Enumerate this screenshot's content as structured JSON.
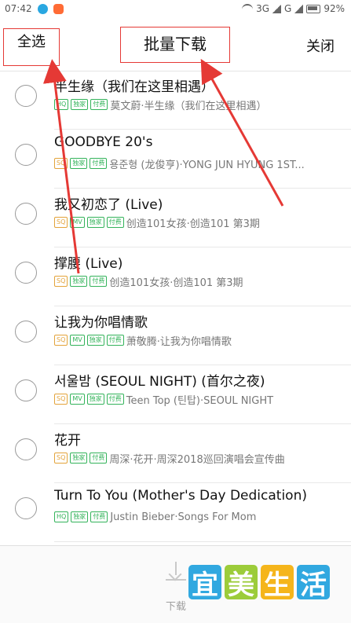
{
  "status_bar": {
    "time": "07:42",
    "network": "3G",
    "network2": "G",
    "battery": "92%"
  },
  "header": {
    "select_all": "全选",
    "title": "批量下载",
    "close": "关闭"
  },
  "songs": [
    {
      "title": "半生缘（我们在这里相遇）",
      "tags": [
        "HQ",
        "独家",
        "付费"
      ],
      "subtitle": "莫文蔚·半生缘（我们在这里相遇）"
    },
    {
      "title": "GOODBYE 20's",
      "tags": [
        "SQ",
        "独家",
        "付费"
      ],
      "subtitle": "용준형 (龙俊亨)·YONG JUN HYUNG 1ST..."
    },
    {
      "title": "我又初恋了 (Live)",
      "tags": [
        "SQ",
        "MV",
        "独家",
        "付费"
      ],
      "subtitle": "创造101女孩·创造101 第3期"
    },
    {
      "title": "撑腰 (Live)",
      "tags": [
        "SQ",
        "独家",
        "付费"
      ],
      "subtitle": "创造101女孩·创造101 第3期"
    },
    {
      "title": "让我为你唱情歌",
      "tags": [
        "SQ",
        "MV",
        "独家",
        "付费"
      ],
      "subtitle": "萧敬腾·让我为你唱情歌"
    },
    {
      "title": "서울밤 (SEOUL NIGHT) (首尔之夜)",
      "tags": [
        "SQ",
        "MV",
        "独家",
        "付费"
      ],
      "subtitle": "Teen Top (틴탑)·SEOUL NIGHT"
    },
    {
      "title": "花开",
      "tags": [
        "SQ",
        "独家",
        "付费"
      ],
      "subtitle": "周深·花开·周深2018巡回演唱会宣传曲"
    },
    {
      "title": "Turn To You (Mother's Day Dedication)",
      "tags": [
        "HQ",
        "独家",
        "付费"
      ],
      "subtitle": "Justin Bieber·Songs For Mom"
    }
  ],
  "bottom": {
    "download_label": "下载"
  },
  "watermark": {
    "chars": [
      "宜",
      "美",
      "生",
      "活"
    ],
    "colors": [
      "#31a8e0",
      "#9ccc3a",
      "#f5b51b",
      "#31a8e0"
    ]
  },
  "colors": {
    "annotation": "#e53935",
    "tag_sq": "#e3a33a",
    "tag_green": "#33b35a"
  }
}
